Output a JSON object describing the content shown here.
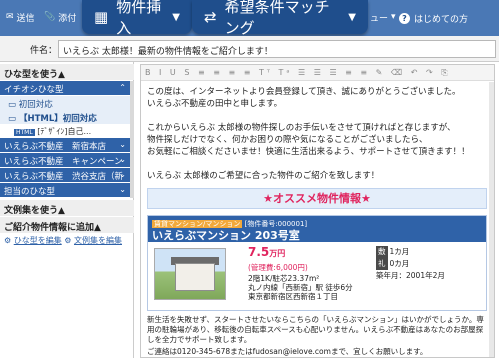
{
  "toolbar": {
    "send_label": "送信",
    "attach_label": "添付",
    "insert_property_label": "物件挿入",
    "matching_label": "希望条件マッチング",
    "menu_partial_label": "ュー",
    "help_label": "はじめての方"
  },
  "subject": {
    "label": "件名：",
    "value": "いえらぶ 太郎様！最新の物件情報をご紹介します！"
  },
  "sidebar": {
    "template_head": "ひな型を使う▲",
    "items": [
      {
        "label": "イチオシひな型"
      },
      {
        "label": "初回対応"
      },
      {
        "label": "【HTML】初回対応"
      },
      {
        "label": "[ﾃﾞｻﾞｲﾝ]自己..."
      },
      {
        "label": "いえらぶ不動産　新宿本店"
      },
      {
        "label": "いえらぶ不動産　キャンペーン"
      },
      {
        "label": "いえらぶ不動産　渋谷支店（新"
      },
      {
        "label": "担当のひな型"
      }
    ],
    "phrase_head": "文例集を使う▲",
    "additional_head": "ご紹介物件情報に追加▲",
    "links": {
      "edit_template": "ひな型を編集",
      "edit_phrases": "文例集を編集"
    }
  },
  "editor": {
    "toolbar_glyphs": "B I U S ≡ ≡ ≡ ≡ Tᵀ Tᵃ ☰ ☰ ☰ ≡ ≡ ✎ ⌫ ↶ ↷ ⎘",
    "greeting": [
      "この度は、インターネットより会員登録して頂き、誠にありがとうございました。",
      "いえらぶ不動産の田中と申します。"
    ],
    "body": [
      "これからいえらぶ 太郎様の物件探しのお手伝いをさせて頂ければと存じますが、",
      "物件探しだけでなく、何かお困りの際や気になることがございましたら、",
      "お気軽にご相談くださいませ！快適に生活出来るよう、サポートさせて頂きます！！"
    ],
    "intro": "いえらぶ 太郎様のご希望に合った物件のご紹介を致します！",
    "promo": "★オススメ物件情報★",
    "property": {
      "type_tag": "賃貸マンション/マンション",
      "id_tag": "[物件番号:000001]",
      "name": "いえらぶマンション 203号室",
      "price": "7.5",
      "price_unit": "万円",
      "mgmt_fee": "(管理費:6,000円)",
      "layout": "2階1K/駐芯23.37m²",
      "station": "丸ノ内線「西新宿」駅 徒歩6分",
      "address": "東京都新宿区西新宿１丁目",
      "cond1_label": "敷",
      "cond1_value": "1カ月",
      "cond2_label": "礼",
      "cond2_value": "0カ月",
      "built": "築年月：2001年2月"
    },
    "footer": [
      "新生活を失敗せず、スタートさせたいならこちらの「いえらぶマンション」はいかがでしょうか。専用の駐輪場があり、移転後の自転車スペースも心配いりません。いえらぶ不動産はあなたのお部屋探しを全力でサポート致します。",
      "ご連絡は0120-345-678またはfudosan@ielove.comまで、宜しくお願いします。"
    ]
  }
}
